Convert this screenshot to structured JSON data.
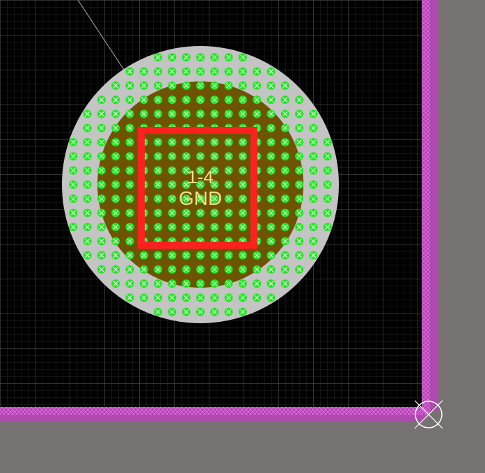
{
  "pad": {
    "designator": "1-4",
    "net": "GND"
  },
  "colors": {
    "board_background": "#000000",
    "outside_area": "#767272",
    "grid_fine": "#2a2a2a",
    "grid_coarse": "#6a6a6a",
    "board_edge": "#c040c0",
    "copper_clearance_ring": "#c4c4c4",
    "pad_copper": "#6e5400",
    "thermal_via": "#26e626",
    "pad_outline": "#ff2020",
    "label_text": "#f2e08a",
    "connection_line": "#b8b49a",
    "origin_marker": "#ffffff"
  },
  "icons": {
    "thermal_via": "via-cross-icon",
    "board_origin": "origin-crosshair-icon"
  }
}
